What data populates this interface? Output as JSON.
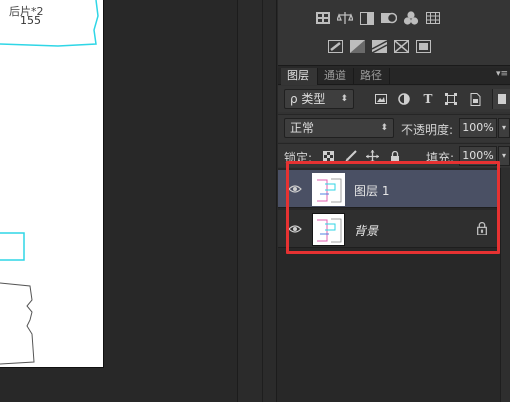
{
  "canvas": {
    "text_line_1": "后片*2",
    "text_line_2": "155"
  },
  "adjustments": {
    "row1_icons": [
      "brightness-contrast-icon",
      "levels-icon",
      "curves-icon",
      "exposure-icon",
      "vibrance-icon",
      "hue-saturation-grid-icon"
    ],
    "row2_icons": [
      "color-balance-icon",
      "black-white-icon",
      "photo-filter-icon",
      "channel-mixer-icon",
      "color-lookup-icon"
    ]
  },
  "layers_panel": {
    "tabs": [
      {
        "label": "图层",
        "active": true
      },
      {
        "label": "通道",
        "active": false
      },
      {
        "label": "路径",
        "active": false
      }
    ],
    "menu_glyph": "▾≡",
    "filter": {
      "label": "ρ 类型",
      "icons": [
        "image-filter-icon",
        "adjustment-filter-icon",
        "text-filter-icon",
        "shape-filter-icon",
        "smart-object-filter-icon"
      ]
    },
    "blend_mode": "正常",
    "opacity_label": "不透明度:",
    "opacity_value": "100%",
    "lock_label": "锁定:",
    "fill_label": "填充:",
    "fill_value": "100%",
    "layers": [
      {
        "name": "图层 1",
        "selected": true,
        "locked": false
      },
      {
        "name": "背景",
        "selected": false,
        "locked": true
      }
    ]
  },
  "colors": {
    "highlight": "#e63232",
    "selected_row": "#4a5064",
    "canvas_line": "#2fd6e6"
  }
}
